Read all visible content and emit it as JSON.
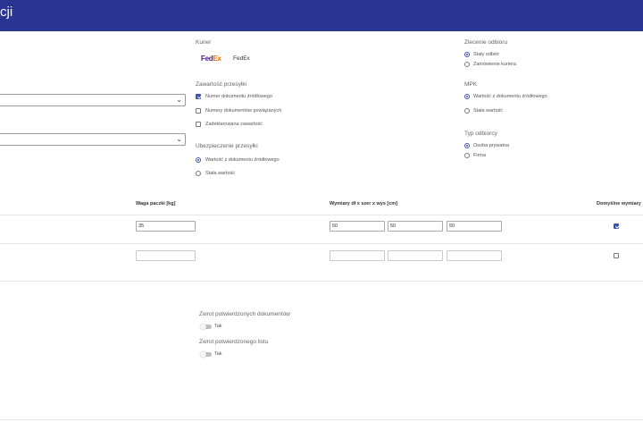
{
  "header": {
    "title": "cji"
  },
  "courier": {
    "label": "Kurier",
    "logo_text_fe": "Fed",
    "logo_text_ex": "Ex",
    "name": "FedEx"
  },
  "contents": {
    "label": "Zawartość przesyłki",
    "options": [
      "Numer dokumentu źródłowego",
      "Numery dokumentów powiązanych",
      "Zadeklarowana zawartość"
    ]
  },
  "insurance": {
    "label": "Ubezpieczenie przesyłki",
    "options": [
      "Wartość z dokumentu źródłowego",
      "Stała wartość"
    ]
  },
  "pickup": {
    "label": "Zlecenie odbioru",
    "options": [
      "Stały odbiór",
      "Zamówienie kuriera"
    ]
  },
  "mpk": {
    "label": "MPK",
    "options": [
      "Wartość z dokumentu źródłowego",
      "Stała wartość"
    ]
  },
  "recipient_type": {
    "label": "Typ odbiorcy",
    "options": [
      "Osoba prywatna",
      "Firma"
    ]
  },
  "table": {
    "headers": {
      "weight": "Waga paczki [kg]",
      "dims": "Wymiary dł x szer x wys [cm]",
      "default": "Domyślne wymiary"
    },
    "rows": [
      {
        "weight": "35",
        "length": "50",
        "width": "50",
        "height": "50",
        "default": true
      },
      {
        "weight": "",
        "length": "",
        "width": "",
        "height": "",
        "default": false
      }
    ]
  },
  "returns": {
    "docs_label": "Zwrot potwierdzonych dokumentów",
    "docs_toggle_label": "Tak",
    "letter_label": "Zwrot potwierdzonego listu",
    "letter_toggle_label": "Tak"
  },
  "colors": {
    "header": "#283593",
    "accent": "#3f51b5"
  }
}
